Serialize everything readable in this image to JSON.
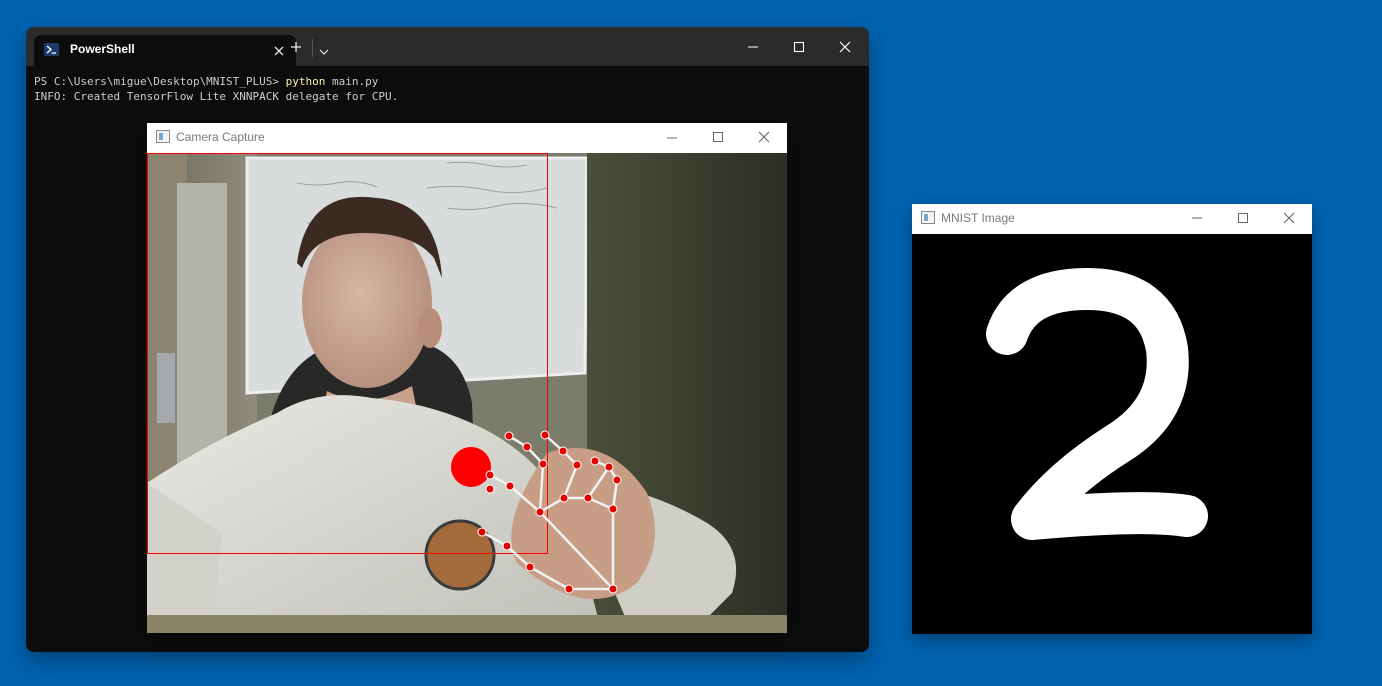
{
  "terminal": {
    "tab_title": "PowerShell",
    "prompt": "PS C:\\Users\\migue\\Desktop\\MNIST_PLUS> ",
    "command_exe": "python",
    "command_args": " main.py",
    "output_line": "INFO: Created TensorFlow Lite XNNPACK delegate for CPU.",
    "icons": {
      "tab_icon": "powershell-icon",
      "tab_close": "close-icon",
      "new_tab": "plus-icon",
      "dropdown": "chevron-down-icon",
      "minimize": "minimize-icon",
      "maximize": "maximize-icon",
      "close": "close-icon"
    }
  },
  "camera_window": {
    "title": "Camera Capture",
    "colors": {
      "roi_box": "#ff0000",
      "landmark": "#e00000",
      "skeleton": "#ffffff",
      "pointer": "#ff0000"
    }
  },
  "mnist_window": {
    "title": "MNIST Image",
    "drawn_digit": "2",
    "colors": {
      "background": "#000000",
      "stroke": "#ffffff"
    }
  },
  "colors": {
    "desktop": "#0063b1",
    "terminal_bg": "#0c0c0c",
    "terminal_text": "#cccccc",
    "command_highlight": "#f9f1a5"
  }
}
